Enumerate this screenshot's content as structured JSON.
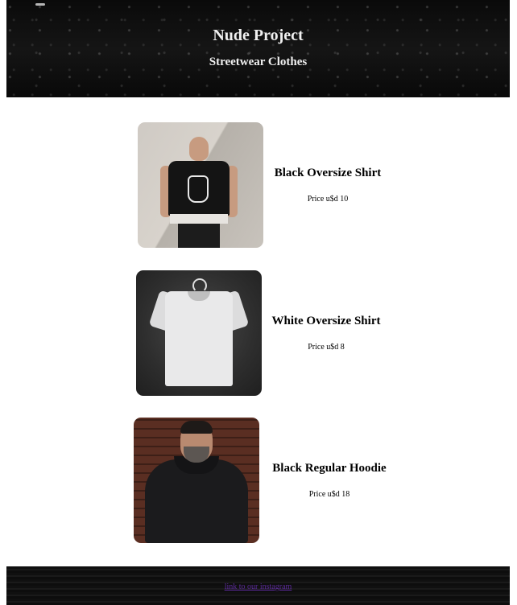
{
  "header": {
    "title": "Nude Project",
    "subtitle": "Streetwear Clothes"
  },
  "products": [
    {
      "name": "Black Oversize Shirt",
      "price": "Price u$d 10",
      "image": "man-black-tee-photo"
    },
    {
      "name": "White Oversize Shirt",
      "price": "Price u$d 8",
      "image": "white-tee-on-hanger-photo"
    },
    {
      "name": "Black Regular Hoodie",
      "price": "Price u$d 18",
      "image": "man-black-hoodie-photo"
    }
  ],
  "footer": {
    "link_label": "link to our instagram"
  },
  "colors": {
    "header_bg": "#0f0f0f",
    "link": "#5b2a9a",
    "text": "#000000"
  }
}
